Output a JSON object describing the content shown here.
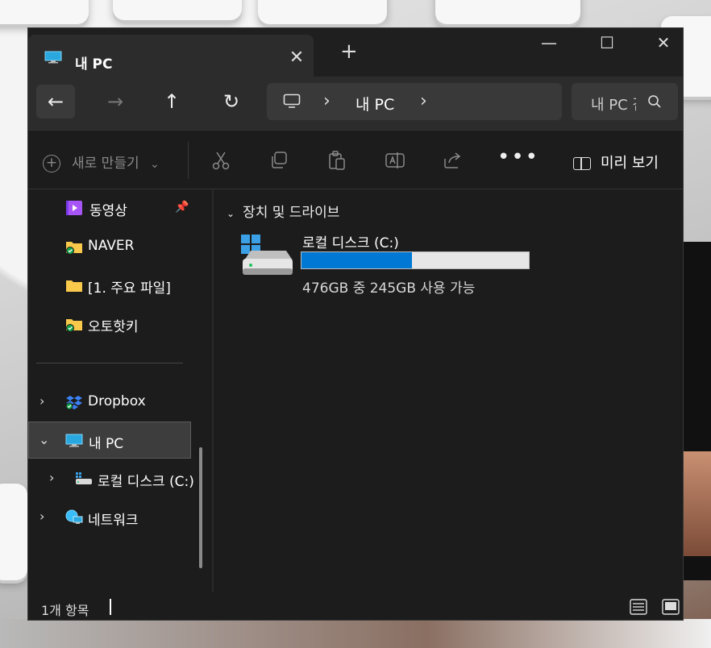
{
  "window": {
    "tab_title": "내 PC",
    "tab_close": "✕",
    "new_tab": "+",
    "minimize": "—",
    "maximize": "☐",
    "close": "✕"
  },
  "nav": {
    "back": "←",
    "forward": "→",
    "up": "↑",
    "refresh": "↻",
    "separator": "›",
    "breadcrumb": "내 PC",
    "search_text": "내 PC 검색"
  },
  "commands": {
    "new_label": "새로 만들기",
    "new_chevron": "⌄",
    "more": "•••",
    "preview_label": "미리 보기"
  },
  "sidebar": {
    "pinned": [
      {
        "label": "동영상",
        "icon": "video-folder-icon"
      },
      {
        "label": "NAVER",
        "icon": "folder-synced-icon"
      },
      {
        "label": "[1. 주요 파일]",
        "icon": "folder-icon"
      },
      {
        "label": "오토핫키",
        "icon": "folder-synced-icon"
      }
    ],
    "tree": [
      {
        "label": "Dropbox",
        "icon": "dropbox-icon",
        "expanded": false
      },
      {
        "label": "내 PC",
        "icon": "pc-icon",
        "expanded": true,
        "selected": true
      },
      {
        "label": "로컬 디스크 (C:)",
        "icon": "drive-icon",
        "expanded": false
      },
      {
        "label": "네트워크",
        "icon": "network-icon",
        "expanded": false
      }
    ],
    "chevron_collapsed": "›",
    "chevron_expanded": "⌄"
  },
  "main": {
    "group_title": "장치 및 드라이브",
    "drive": {
      "name": "로컬 디스크 (C:)",
      "used_fraction": 0.485,
      "free_text": "476GB 중 245GB 사용 가능",
      "bar_color": "#0078d4"
    }
  },
  "status": {
    "count_text": "1개 항목"
  }
}
